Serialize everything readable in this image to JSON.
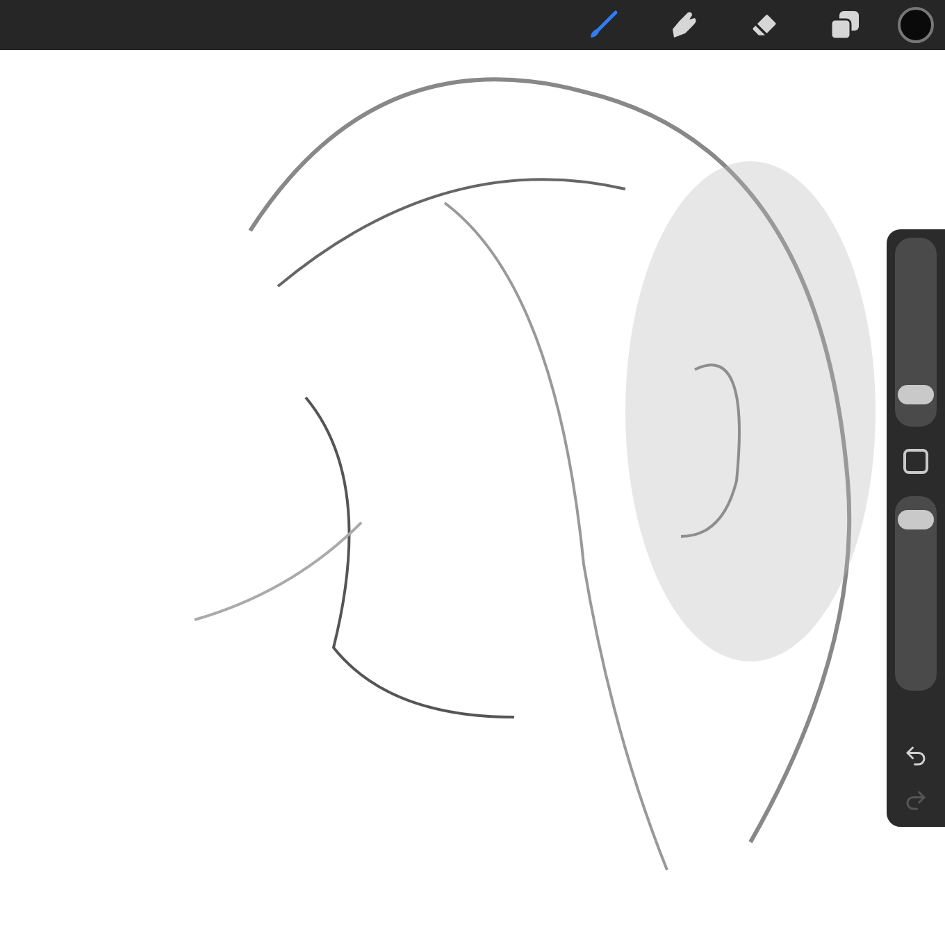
{
  "toolbar": {
    "tools": [
      {
        "kind": "brush",
        "selected": true
      },
      {
        "kind": "smudge",
        "selected": false
      },
      {
        "kind": "eraser",
        "selected": false
      },
      {
        "kind": "layers",
        "selected": false
      }
    ],
    "color_swatch": {
      "color": "#0a0a0a"
    }
  },
  "sidebar": {
    "brush_size": {
      "level": 0.13
    },
    "opacity": {
      "level": 0.92
    },
    "undo": {
      "disabled": false
    },
    "redo": {
      "disabled": true
    }
  }
}
